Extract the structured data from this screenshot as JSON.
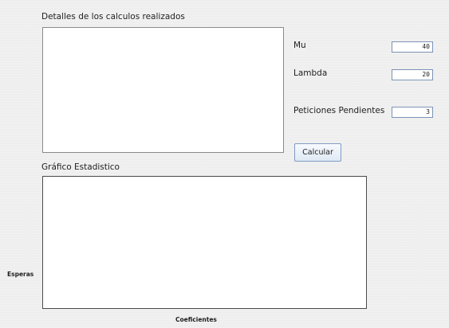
{
  "details": {
    "title": "Detalles de los calculos realizados",
    "content": ""
  },
  "params": {
    "mu": {
      "label": "Mu",
      "value": "40"
    },
    "lambda": {
      "label": "Lambda",
      "value": "20"
    },
    "pending": {
      "label": "Peticiones Pendientes",
      "value": "3"
    }
  },
  "calc_button": "Calcular",
  "chart": {
    "title": "Gráfico Estadistico",
    "ylabel": "Esperas",
    "xlabel": "Coeficientes"
  }
}
